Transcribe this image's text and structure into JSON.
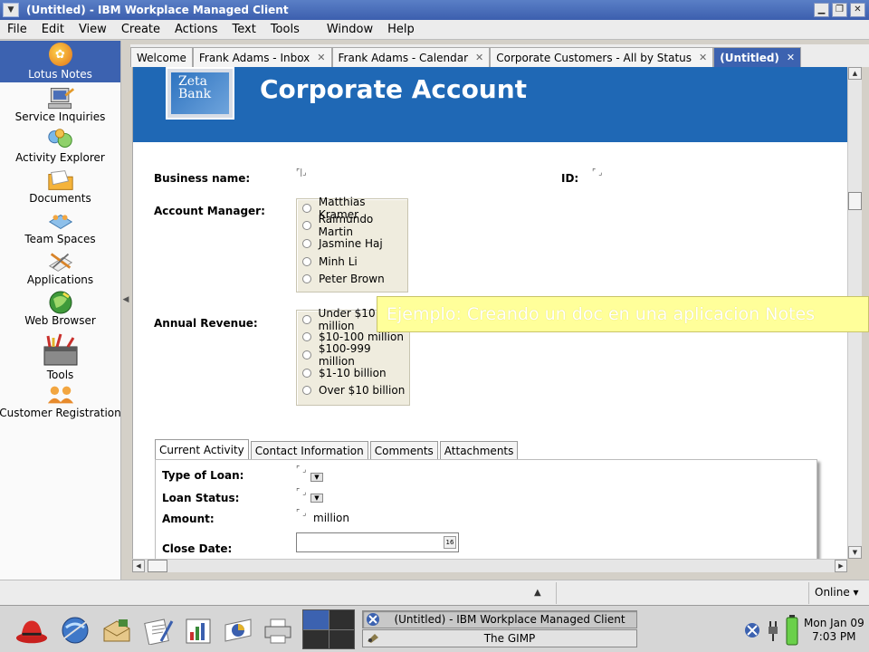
{
  "window": {
    "title": "(Untitled) - IBM Workplace Managed Client"
  },
  "menu": [
    "File",
    "Edit",
    "View",
    "Create",
    "Actions",
    "Text",
    "Tools",
    "Window",
    "Help"
  ],
  "sidebar": {
    "home": "Lotus Notes",
    "items": [
      {
        "label": "Service Inquiries",
        "icon": "computer-icon"
      },
      {
        "label": "Activity Explorer",
        "icon": "activity-icon"
      },
      {
        "label": "Documents",
        "icon": "folder-icon"
      },
      {
        "label": "Team Spaces",
        "icon": "team-icon"
      },
      {
        "label": "Applications",
        "icon": "applications-icon"
      },
      {
        "label": "Web Browser",
        "icon": "globe-icon"
      },
      {
        "label": "Tools",
        "icon": "toolbox-icon"
      },
      {
        "label": "Customer Registration",
        "icon": "people-icon"
      }
    ]
  },
  "tabs": [
    {
      "label": "Welcome"
    },
    {
      "label": "Frank Adams - Inbox"
    },
    {
      "label": "Frank Adams - Calendar"
    },
    {
      "label": "Corporate Customers - All by Status"
    },
    {
      "label": "(Untitled)"
    }
  ],
  "form": {
    "logo_line1": "Zeta",
    "logo_line2": "Bank",
    "title": "Corporate Account",
    "business_name_label": "Business name:",
    "id_label": "ID:",
    "account_manager_label": "Account Manager:",
    "account_managers": [
      "Matthias Kramer",
      "Raimundo Martin",
      "Jasmine Haj",
      "Minh Li",
      "Peter Brown"
    ],
    "annual_revenue_label": "Annual Revenue:",
    "revenues": [
      "Under $10 million",
      "$10-100 million",
      "$100-999 million",
      "$1-10 billion",
      "Over $10 billion"
    ],
    "inner_tabs": [
      "Current Activity",
      "Contact Information",
      "Comments",
      "Attachments"
    ],
    "type_of_loan_label": "Type of Loan:",
    "loan_status_label": "Loan Status:",
    "amount_label": "Amount:",
    "amount_unit": "million",
    "close_date_label": "Close Date:",
    "calendar_day": "16"
  },
  "tooltip": "Ejemplo: Creando un doc en una aplicacion Notes",
  "status": {
    "online": "Online"
  },
  "taskbar": {
    "tasks": [
      "(Untitled) - IBM Workplace Managed Client",
      "The GIMP"
    ],
    "clock_date": "Mon Jan 09",
    "clock_time": "7:03 PM"
  },
  "colors": {
    "accent": "#3c62b0",
    "banner": "#1f68b5",
    "tooltip": "#ffff9a"
  }
}
